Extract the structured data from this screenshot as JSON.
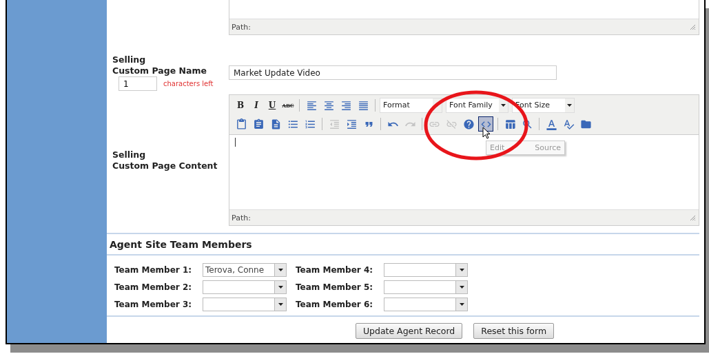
{
  "top_editor": {
    "path_label": "Path:"
  },
  "page_name": {
    "label_lines": [
      "Selling",
      "Custom Page Name"
    ],
    "value": "Market Update Video",
    "counter": "1",
    "counter_note": "characters left"
  },
  "content_editor": {
    "label_lines": [
      "Selling",
      "Custom Page Content"
    ],
    "toolbar_row_1": [
      {
        "kind": "text",
        "text": "B"
      },
      {
        "kind": "text",
        "text": "I"
      },
      {
        "kind": "text",
        "text": "U"
      },
      {
        "kind": "text",
        "text": "ABC"
      },
      {
        "kind": "sep"
      },
      {
        "kind": "icon"
      },
      {
        "kind": "icon"
      },
      {
        "kind": "icon"
      },
      {
        "kind": "icon"
      },
      {
        "kind": "sep"
      },
      {
        "kind": "select",
        "text": "Format"
      },
      {
        "kind": "select",
        "text": "Font Family"
      },
      {
        "kind": "select",
        "text": "Font Size"
      }
    ],
    "toolbar_row_2": [
      {
        "kind": "icon",
        "disabled": false,
        "hovered": false
      },
      {
        "kind": "icon",
        "disabled": false,
        "hovered": false
      },
      {
        "kind": "icon",
        "disabled": false,
        "hovered": false
      },
      {
        "kind": "icon",
        "disabled": false,
        "hovered": false
      },
      {
        "kind": "icon",
        "disabled": false,
        "hovered": false
      },
      {
        "kind": "sep"
      },
      {
        "kind": "icon",
        "disabled": true,
        "hovered": false
      },
      {
        "kind": "icon",
        "disabled": false,
        "hovered": false
      },
      {
        "kind": "icon",
        "disabled": false,
        "hovered": false
      },
      {
        "kind": "sep"
      },
      {
        "kind": "icon",
        "disabled": false,
        "hovered": false
      },
      {
        "kind": "icon",
        "disabled": true,
        "hovered": false
      },
      {
        "kind": "sep"
      },
      {
        "kind": "icon",
        "disabled": true,
        "hovered": false
      },
      {
        "kind": "icon",
        "disabled": true,
        "hovered": false
      },
      {
        "kind": "icon",
        "disabled": false,
        "hovered": false
      },
      {
        "kind": "icon",
        "disabled": false,
        "hovered": true
      },
      {
        "kind": "sep"
      },
      {
        "kind": "icon",
        "disabled": false,
        "hovered": false
      },
      {
        "kind": "icon",
        "disabled": false,
        "hovered": false
      },
      {
        "kind": "sep"
      },
      {
        "kind": "icon",
        "disabled": false,
        "hovered": false
      },
      {
        "kind": "icon",
        "disabled": false,
        "hovered": false
      },
      {
        "kind": "icon",
        "disabled": false,
        "hovered": false
      }
    ],
    "tooltip": [
      "Edit",
      "Source"
    ],
    "path_label": "Path:"
  },
  "team": {
    "title": "Agent Site Team Members",
    "members": [
      {
        "label": "Team Member 1:",
        "value": "Terova, Conne"
      },
      {
        "label": "Team Member 2:"
      },
      {
        "label": "Team Member 3:"
      },
      {
        "label": "Team Member 4:"
      },
      {
        "label": "Team Member 5:"
      },
      {
        "label": "Team Member 6:"
      }
    ]
  },
  "buttons": [
    {
      "label": "Update Agent Record"
    },
    {
      "label": "Reset this form"
    }
  ]
}
